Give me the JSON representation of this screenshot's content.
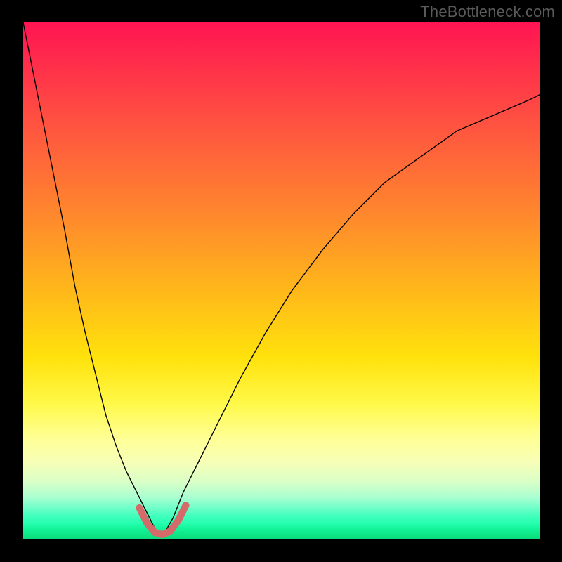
{
  "watermark": "TheBottleneck.com",
  "chart_data": {
    "type": "line",
    "title": "",
    "xlabel": "",
    "ylabel": "",
    "xlim": [
      0,
      100
    ],
    "ylim": [
      0,
      100
    ],
    "grid": false,
    "legend": false,
    "series": [
      {
        "name": "left-curve",
        "x": [
          0,
          2,
          4,
          6,
          8,
          10,
          12,
          14,
          16,
          18,
          20,
          22,
          24,
          25.5,
          27
        ],
        "y": [
          100,
          90,
          80,
          70,
          60,
          49,
          40,
          32,
          24,
          18,
          13,
          9,
          5,
          2,
          0.5
        ]
      },
      {
        "name": "right-curve",
        "x": [
          27,
          29,
          31,
          34,
          38,
          42,
          47,
          52,
          58,
          64,
          70,
          77,
          84,
          91,
          98,
          100
        ],
        "y": [
          0.5,
          4,
          9,
          15,
          23,
          31,
          40,
          48,
          56,
          63,
          69,
          74,
          79,
          82,
          85,
          86
        ]
      },
      {
        "name": "bottom-highlight",
        "x": [
          22.5,
          24,
          25.5,
          27,
          28.5,
          30,
          31.5
        ],
        "y": [
          6,
          3,
          1.2,
          0.8,
          1.5,
          3.5,
          6.5
        ]
      }
    ]
  }
}
